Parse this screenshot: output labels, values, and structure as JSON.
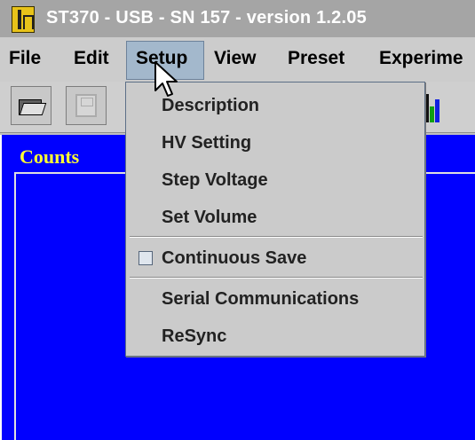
{
  "window": {
    "title": "ST370 - USB - SN 157 - version 1.2.05",
    "app_icon": "meter-icon"
  },
  "menubar": {
    "items": [
      "File",
      "Edit",
      "Setup",
      "View",
      "Preset",
      "Experime"
    ],
    "active": "Setup"
  },
  "toolbar": {
    "buttons": [
      {
        "icon": "open-folder-icon"
      },
      {
        "icon": "save-disk-icon",
        "enabled": false
      },
      {
        "icon": "chart-icon"
      }
    ]
  },
  "panel": {
    "label": "Counts",
    "background": "#0000ff",
    "label_color": "#ffff33"
  },
  "setup_menu": {
    "items": [
      {
        "label": "Description"
      },
      {
        "label": "HV Setting"
      },
      {
        "label": "Step Voltage"
      },
      {
        "label": "Set Volume"
      },
      {
        "label": "Continuous Save",
        "type": "checkbox",
        "checked": false
      },
      {
        "label": "Serial Communications"
      },
      {
        "label": "ReSync"
      }
    ]
  }
}
